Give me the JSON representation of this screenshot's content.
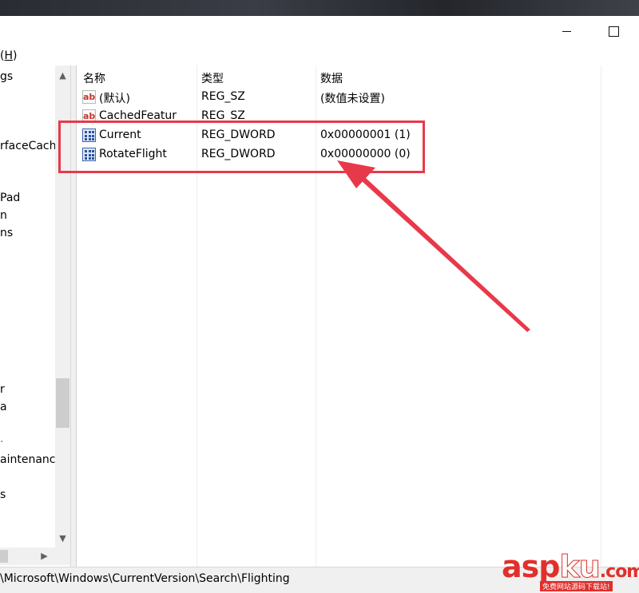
{
  "menu": {
    "help_label": "H",
    "help_prefix": "",
    "help_suffix": ")"
  },
  "tree": {
    "items": [
      {
        "label": "gs"
      },
      {
        "label": "rfaceCach"
      },
      {
        "label": "Pad"
      },
      {
        "label": "n"
      },
      {
        "label": "ns"
      },
      {
        "label": "r"
      },
      {
        "label": "a"
      },
      {
        "label": "."
      },
      {
        "label": "aintenanc"
      },
      {
        "label": "s"
      }
    ]
  },
  "list": {
    "headers": {
      "name": "名称",
      "type": "类型",
      "data": "数据"
    },
    "rows": [
      {
        "icon": "reg-string-icon",
        "name": "(默认)",
        "type": "REG_SZ",
        "data": "(数值未设置)"
      },
      {
        "icon": "reg-string-icon",
        "name": "CachedFeatur",
        "type": "REG_SZ",
        "data": ""
      },
      {
        "icon": "reg-binary-icon",
        "name": "Current",
        "type": "REG_DWORD",
        "data": "0x00000001 (1)"
      },
      {
        "icon": "reg-binary-icon",
        "name": "RotateFlight",
        "type": "REG_DWORD",
        "data": "0x00000000 (0)"
      }
    ]
  },
  "status": {
    "path": "\\Microsoft\\Windows\\CurrentVersion\\Search\\Flighting"
  },
  "watermark": {
    "red": "asp",
    "white": "ku",
    "dot": ".com",
    "sub": "免费网站源码下载站!"
  },
  "colors": {
    "annotation": "#e8394a",
    "watermark": "#e0302b"
  }
}
